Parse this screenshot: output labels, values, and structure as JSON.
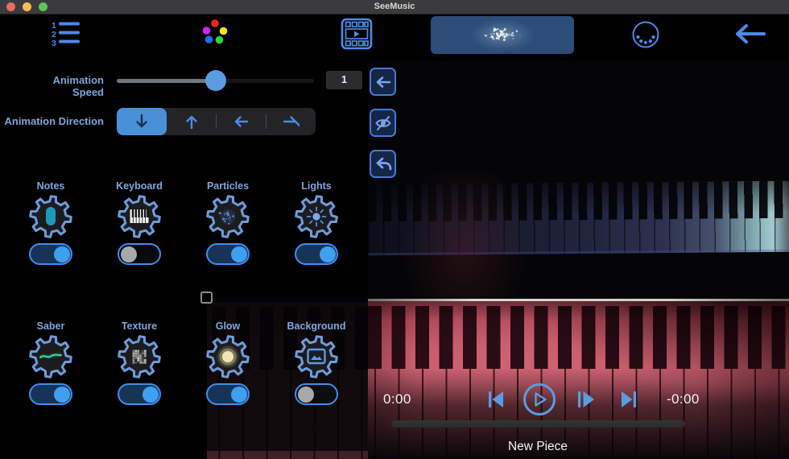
{
  "window": {
    "title": "SeeMusic"
  },
  "toolbar": {
    "icons": [
      "ordered-list-icon",
      "color-dots-icon",
      "film-icon",
      "particles-preview",
      "midi-connector-icon",
      "back-arrow-icon"
    ],
    "particles_preview_selected": true
  },
  "settings": {
    "speed_label": "Animation Speed",
    "speed_value": "1",
    "speed_percent": 50,
    "direction_label": "Animation Direction",
    "direction_options": [
      {
        "icon": "arrow-down",
        "selected": true
      },
      {
        "icon": "arrow-up",
        "selected": false
      },
      {
        "icon": "arrow-left",
        "selected": false
      },
      {
        "icon": "arrow-right",
        "selected": false
      }
    ],
    "toggles": [
      {
        "label": "Notes",
        "icon": "note",
        "on": true
      },
      {
        "label": "Keyboard",
        "icon": "keyboard",
        "on": false
      },
      {
        "label": "Particles",
        "icon": "particles",
        "on": true
      },
      {
        "label": "Lights",
        "icon": "lights",
        "on": true
      },
      {
        "label": "Saber",
        "icon": "saber",
        "on": true
      },
      {
        "label": "Texture",
        "icon": "texture",
        "on": true
      },
      {
        "label": "Glow",
        "icon": "glow",
        "on": true
      },
      {
        "label": "Background",
        "icon": "background",
        "on": false
      }
    ]
  },
  "viewer_buttons": [
    "collapse-left",
    "hide-eye",
    "undo"
  ],
  "player": {
    "elapsed": "0:00",
    "remaining": "-0:00",
    "title": "New Piece",
    "buttons": [
      "skip-back",
      "play",
      "step-forward",
      "skip-next"
    ],
    "progress_percent": 0
  },
  "colors": {
    "accent_blue": "#4d8ae8",
    "label_blue": "#7fa6dd",
    "selected_segment": "#4a90d9",
    "toggle_on_knob": "#3f9ff0",
    "toggle_on_track": "#173457",
    "toggle_off_knob": "#a9a9a9",
    "preview_button_bg": "#2b4d78",
    "side_button_bg": "#152747",
    "side_button_border": "#4678d8",
    "player_icon_blue": "#5b9ce0",
    "traffic_red": "#ed6a5f",
    "traffic_yellow": "#f5bf4f",
    "traffic_green": "#61c555"
  }
}
